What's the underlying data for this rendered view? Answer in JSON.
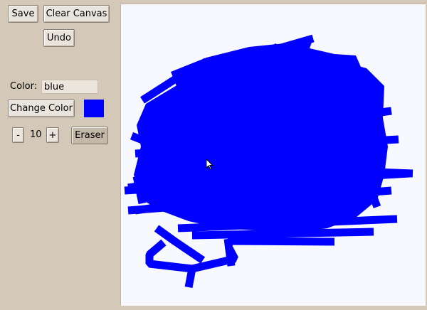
{
  "toolbar": {
    "save_label": "Save",
    "clear_label": "Clear Canvas",
    "undo_label": "Undo"
  },
  "color": {
    "label": "Color:",
    "value": "blue",
    "change_label": "Change Color",
    "swatch_hex": "#0000ff"
  },
  "brush": {
    "decrease_label": "-",
    "size": "10",
    "increase_label": "+",
    "eraser_label": "Eraser"
  },
  "canvas": {
    "background_hex": "#f8f8ff",
    "stroke_hex": "#0000ff"
  },
  "icons": {
    "cursor": "mouse-pointer-icon"
  }
}
